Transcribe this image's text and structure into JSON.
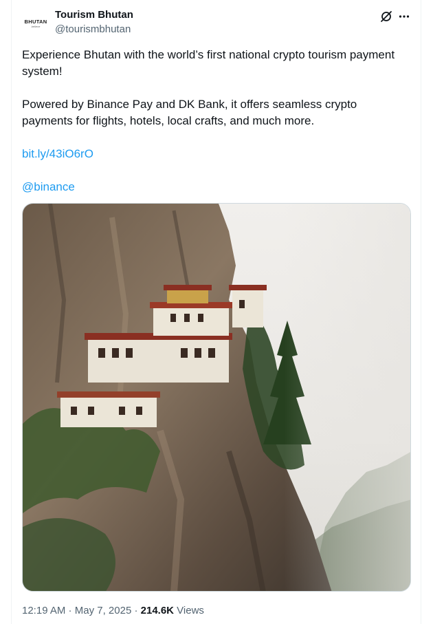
{
  "account": {
    "display_name": "Tourism Bhutan",
    "handle": "@tourismbhutan",
    "avatar_text": "BHUTAN",
    "avatar_sub": "believe"
  },
  "tweet": {
    "paragraph1": "Experience Bhutan with the world’s first national crypto tourism payment system!",
    "paragraph2": "Powered by Binance Pay and DK Bank, it offers seamless crypto payments for flights, hotels, local crafts, and much more.",
    "link": "bit.ly/43iO6rO",
    "mention": "@binance",
    "media_icon": "cliffside-monastery-photo"
  },
  "meta": {
    "time": "12:19 AM",
    "separator1": " · ",
    "date": "May 7, 2025",
    "separator2": " · ",
    "views_count": "214.6K",
    "views_label": " Views"
  },
  "icons": {
    "grok": "grok-icon",
    "more": "more-icon"
  },
  "colors": {
    "link": "#1d9bf0",
    "secondary_text": "#536471",
    "primary_text": "#0f1419"
  }
}
